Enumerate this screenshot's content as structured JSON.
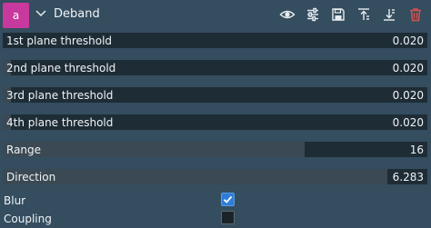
{
  "header": {
    "badge": "a",
    "title": "Deband",
    "icons": [
      "visibility-eye-icon",
      "adjust-sliders-icon",
      "save-icon",
      "move-up-icon",
      "move-down-icon",
      "delete-trash-icon"
    ]
  },
  "sliders": [
    {
      "label": "1st plane threshold",
      "value": "0.020",
      "fill": 0.0
    },
    {
      "label": "2nd plane threshold",
      "value": "0.020",
      "fill": 0.02
    },
    {
      "label": "3rd plane threshold",
      "value": "0.020",
      "fill": 0.02
    },
    {
      "label": "4th plane threshold",
      "value": "0.020",
      "fill": 0.02
    },
    {
      "label": "Range",
      "value": "16",
      "fill": 0.71
    },
    {
      "label": "Direction",
      "value": "6.283",
      "fill": 0.905
    }
  ],
  "checks": [
    {
      "label": "Blur",
      "checked": true
    },
    {
      "label": "Coupling",
      "checked": false
    }
  ],
  "colors": {
    "background": "#344d5f",
    "badge": "#c8399e",
    "checked": "#2f7dd8",
    "track": "#1e2c36",
    "fill": "#3a4953"
  }
}
